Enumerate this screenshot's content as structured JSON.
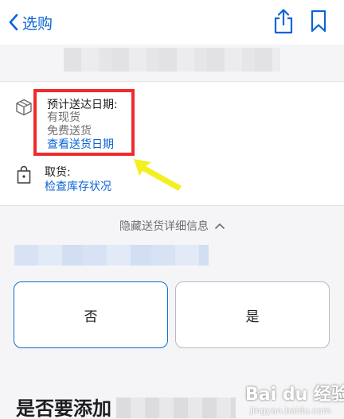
{
  "nav": {
    "back_label": "选购",
    "icons": [
      "chevron-left-icon",
      "share-icon",
      "bookmark-icon"
    ]
  },
  "delivery": {
    "title": "预计送达日期:",
    "availability": "有现货",
    "shipping": "免费送货",
    "check_date_link": "查看送货日期",
    "icon": "box-icon"
  },
  "pickup": {
    "title": "取货:",
    "check_stock_link": "检查库存状况",
    "icon": "bag-icon"
  },
  "details_toggle": {
    "label": "隐藏送货详细信息",
    "icon": "chevron-up-icon"
  },
  "choices": {
    "no_label": "否",
    "yes_label": "是"
  },
  "question": {
    "text": "是否要添加"
  },
  "watermark": {
    "url": "jingyan.baidu.com"
  },
  "colors": {
    "accent": "#0a64d6",
    "annotation_red": "#ef2b2b",
    "arrow_yellow": "#f4ef1f",
    "section_bg": "#f5f5f7"
  }
}
